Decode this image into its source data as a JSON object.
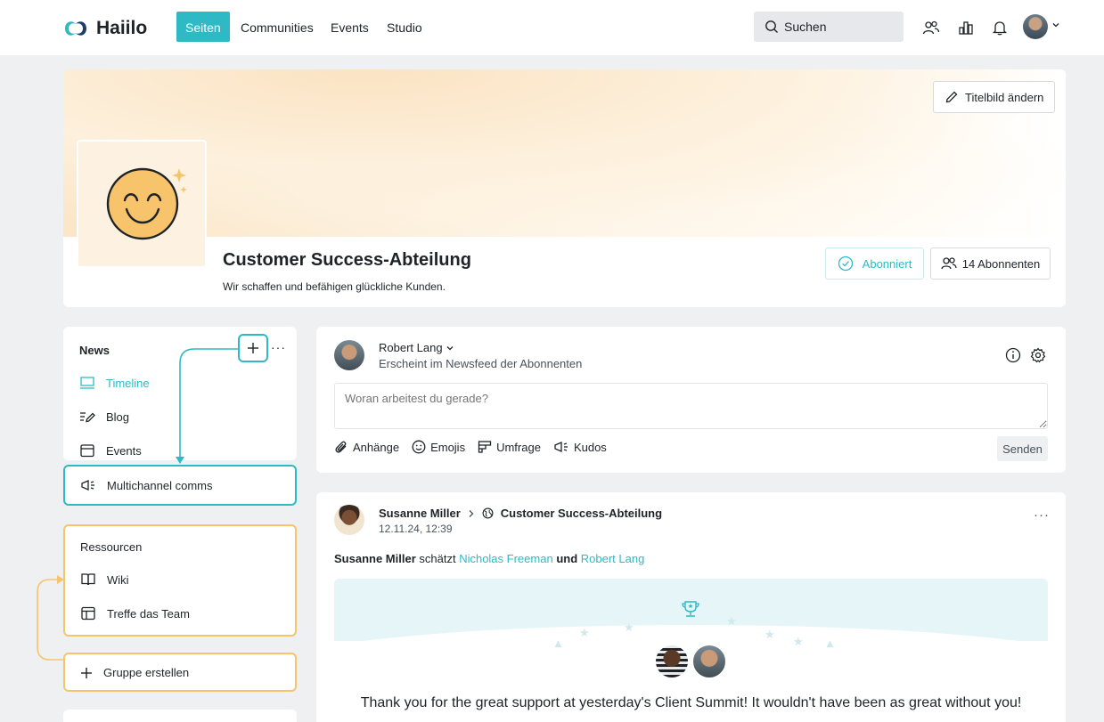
{
  "app": {
    "logo_text": "Haiilo",
    "nav": [
      {
        "label": "Seiten",
        "active": true
      },
      {
        "label": "Communities",
        "active": false
      },
      {
        "label": "Events",
        "active": false
      },
      {
        "label": "Studio",
        "active": false
      }
    ],
    "search_placeholder": "Suchen",
    "accent_color": "#2fb9c4",
    "header_icons": [
      "people-icon",
      "bar-chart-icon",
      "bell-icon",
      "user-avatar",
      "chevron-down-icon"
    ]
  },
  "page": {
    "change_cover_label": "Titelbild ändern",
    "title": "Customer Success-Abteilung",
    "subtitle": "Wir schaffen und befähigen glückliche Kunden.",
    "subscribed_label": "Abonniert",
    "subscribers_label": "14 Abonnenten"
  },
  "sidebar": {
    "news_title": "News",
    "news_items": [
      {
        "label": "Timeline",
        "icon": "monitor-icon",
        "active": true
      },
      {
        "label": "Blog",
        "icon": "pen-lines-icon"
      },
      {
        "label": "Events",
        "icon": "calendar-icon"
      },
      {
        "label": "Multichannel comms",
        "icon": "megaphone-icon"
      }
    ],
    "resources_title": "Ressourcen",
    "resource_items": [
      {
        "label": "Wiki",
        "icon": "book-icon"
      },
      {
        "label": "Treffe das Team",
        "icon": "layout-icon"
      }
    ],
    "create_group_label": "Gruppe erstellen"
  },
  "composer": {
    "author": "Robert Lang",
    "audience": "Erscheint im Newsfeed der Abonnenten",
    "placeholder": "Woran arbeitest du gerade?",
    "actions": [
      {
        "label": "Anhänge",
        "icon": "paperclip-icon"
      },
      {
        "label": "Emojis",
        "icon": "smiley-icon"
      },
      {
        "label": "Umfrage",
        "icon": "poll-icon"
      },
      {
        "label": "Kudos",
        "icon": "megaphone-icon"
      }
    ],
    "send_label": "Senden"
  },
  "post": {
    "author": "Susanne Miller",
    "target": "Customer Success-Abteilung",
    "date": "12.11.24, 12:39",
    "line_author": "Susanne Miller",
    "line_verb": "schätzt",
    "line_person1": "Nicholas Freeman",
    "line_and": "und",
    "line_person2": "Robert Lang",
    "kudos_text": "Thank you for the great support at yesterday's Client Summit! It wouldn't have been as great without you!"
  }
}
